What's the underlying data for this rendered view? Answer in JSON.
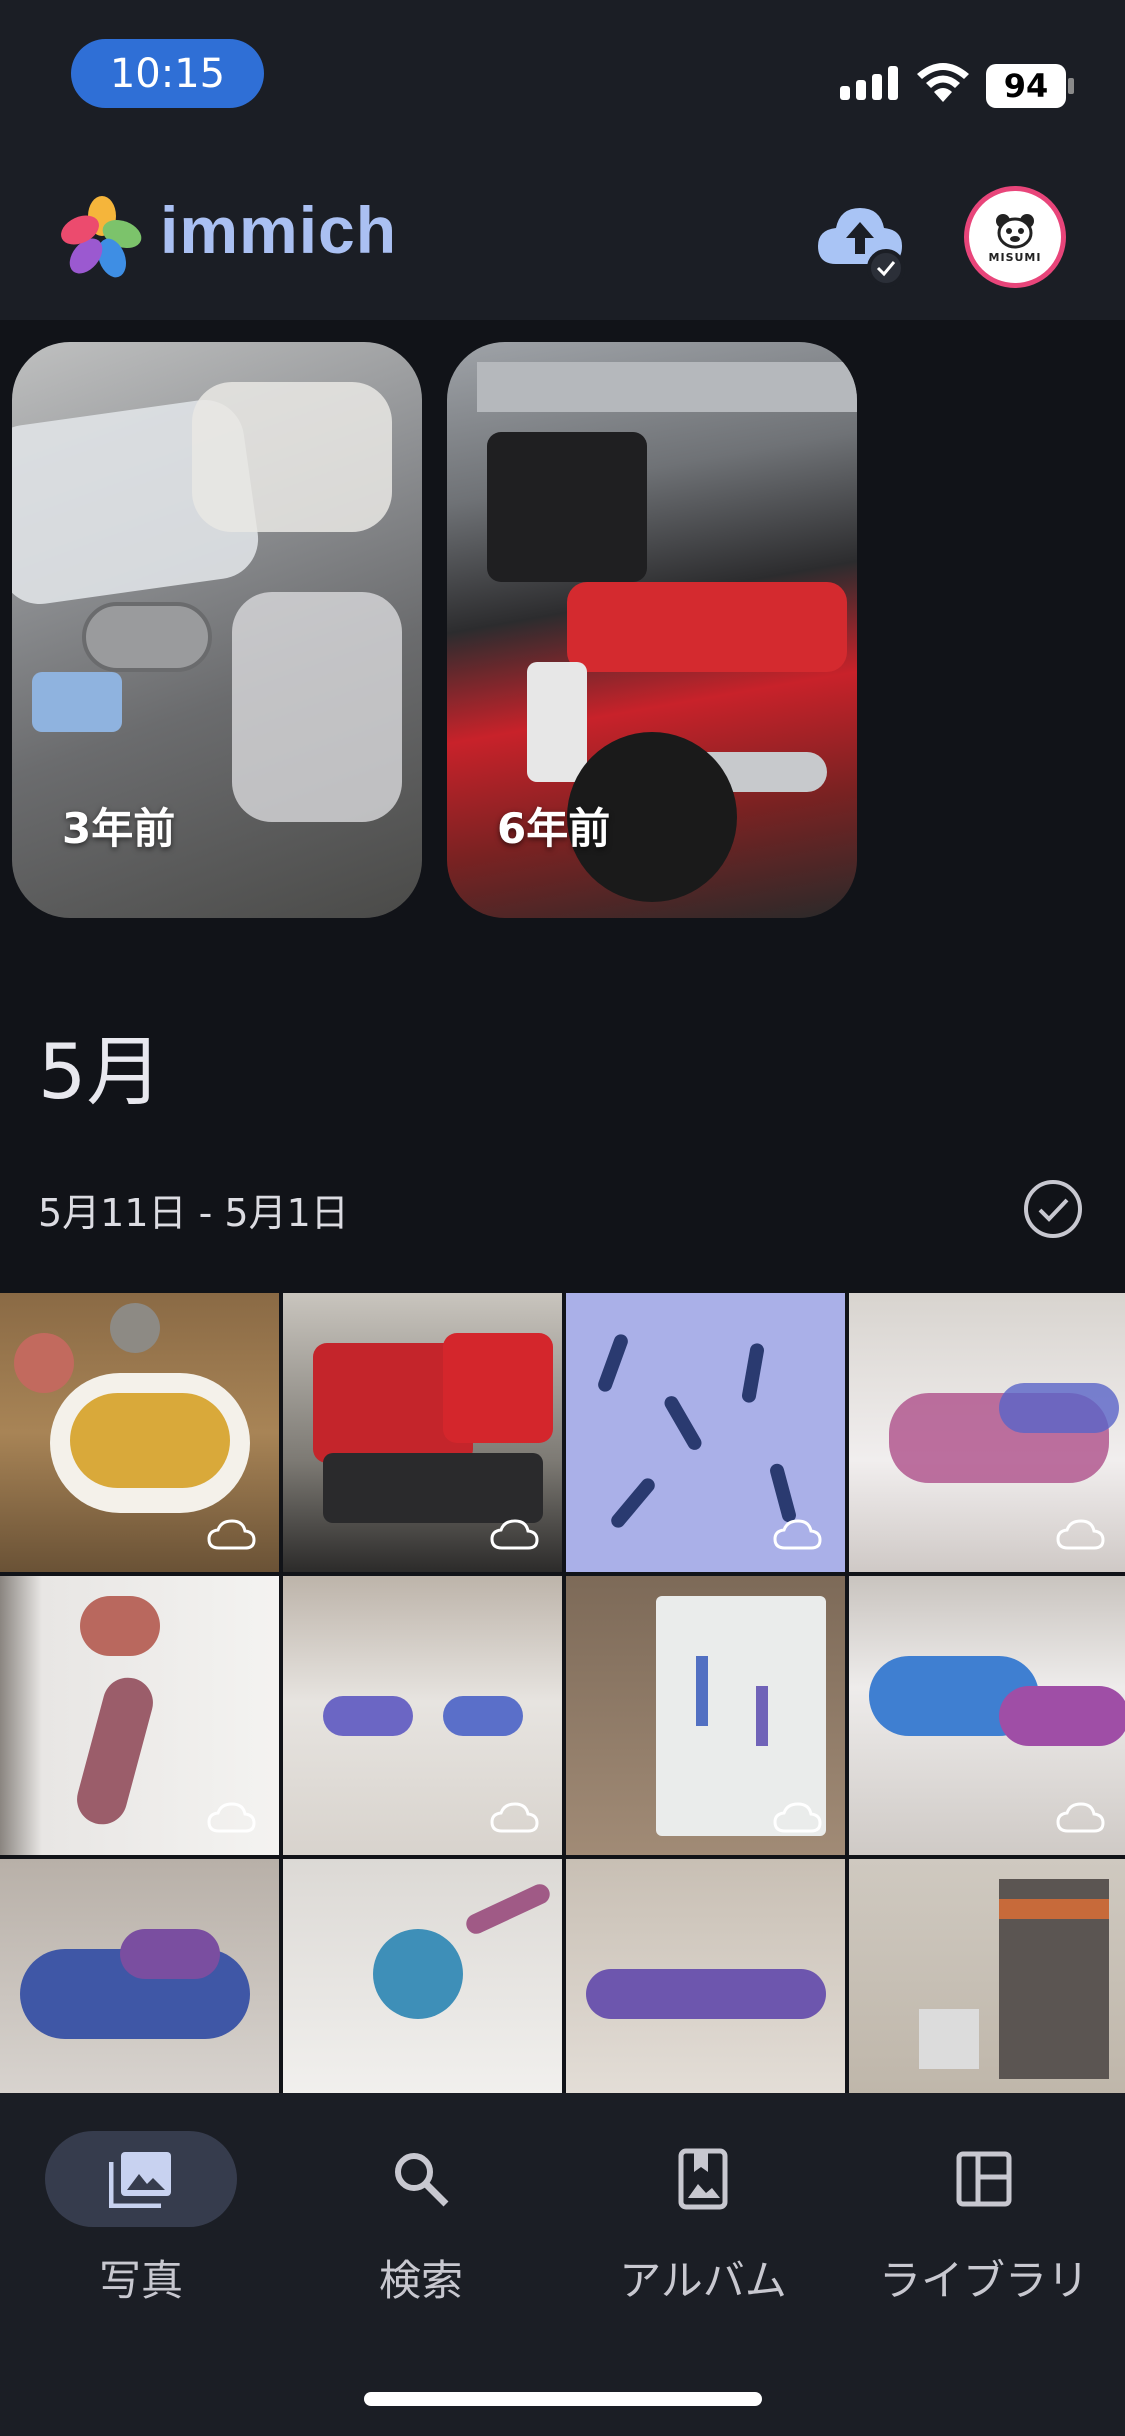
{
  "status_bar": {
    "time": "10:15",
    "battery": "94"
  },
  "app_bar": {
    "brand": "immich",
    "avatar_label": "MISUMI"
  },
  "memories": [
    {
      "label": "3年前"
    },
    {
      "label": "6年前"
    }
  ],
  "timeline": {
    "month": "5月",
    "date_range": "5月11日 - 5月1日"
  },
  "bottom_nav": [
    {
      "label": "写真",
      "icon": "photos-icon",
      "active": true
    },
    {
      "label": "検索",
      "icon": "search-icon",
      "active": false
    },
    {
      "label": "アルバム",
      "icon": "album-icon",
      "active": false
    },
    {
      "label": "ライブラリ",
      "icon": "library-icon",
      "active": false
    }
  ],
  "colors": {
    "background": "#111318",
    "bar": "#1b1e25",
    "accent": "#2f6fd6",
    "brand_text": "#aac0f2",
    "active_pill": "#363c4d"
  }
}
